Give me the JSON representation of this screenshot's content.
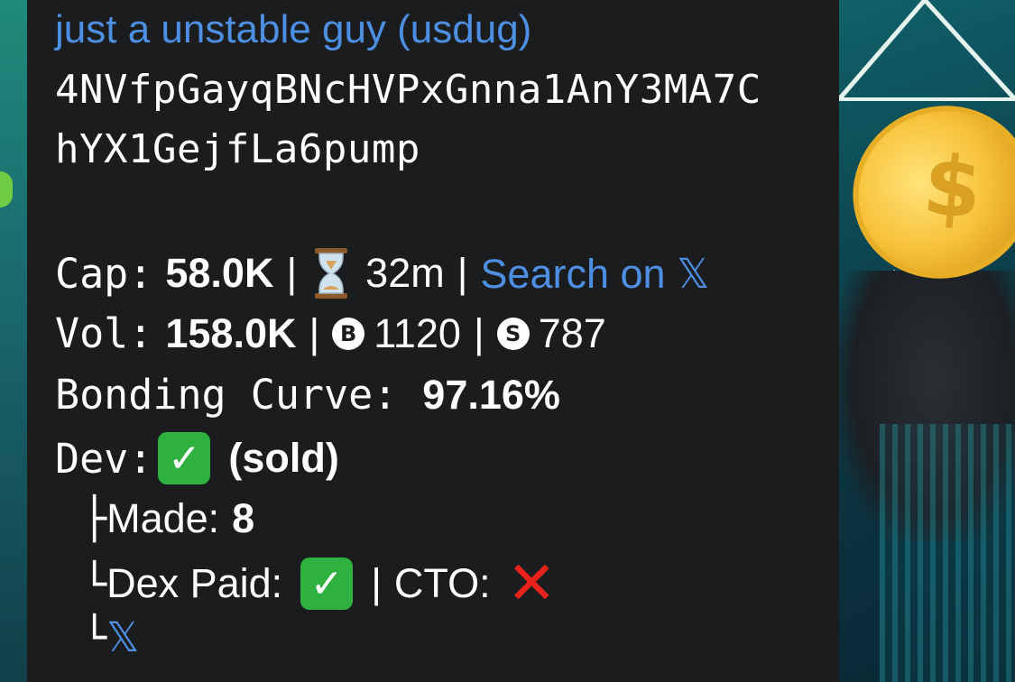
{
  "token": {
    "name_link": "just a unstable guy (usdug)",
    "contract_line1": "4NVfpGayqBNcHVPxGnna1AnY3MA7C",
    "contract_line2": "hYX1GejfLa6pump"
  },
  "stats": {
    "cap_label": "Cap:",
    "cap_value": "58.0K",
    "sep": "|",
    "age_value": "32m",
    "search_link": "Search on",
    "search_x": "𝕏",
    "vol_label": "Vol:",
    "vol_value": "158.0K",
    "buys_icon_letter": "B",
    "buys_value": "1120",
    "sells_icon_letter": "S",
    "sells_value": "787",
    "bonding_label": "Bonding Curve:",
    "bonding_value": "97.16%"
  },
  "dev": {
    "label": "Dev:",
    "status": "(sold)",
    "made_prefix": "├",
    "made_label": "Made:",
    "made_value": "8",
    "dex_prefix": "└",
    "dex_label": "Dex Paid:",
    "cto_label": "CTO:",
    "x_prefix": "└",
    "x_link": "𝕏"
  },
  "icons": {
    "check": "✓",
    "cross": "✕"
  },
  "colors": {
    "link": "#4d8fe3",
    "check_bg": "#2fb140",
    "cross": "#e8221b",
    "bubble": "#1b1c1e"
  }
}
